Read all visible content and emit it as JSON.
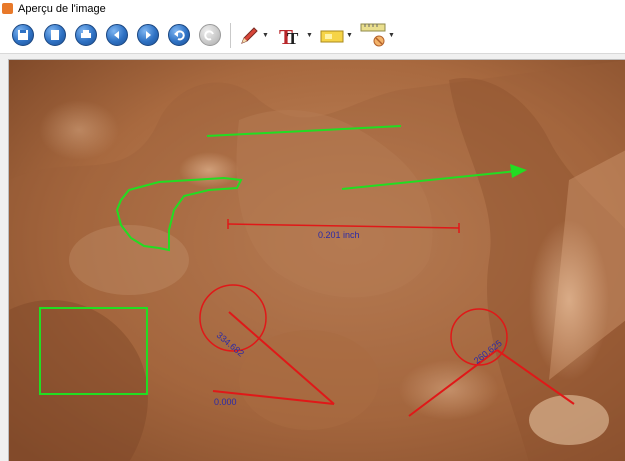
{
  "window": {
    "title": "Aperçu de l'image"
  },
  "toolbar": {
    "buttons": [
      {
        "name": "save-icon",
        "tone": "blue"
      },
      {
        "name": "document-icon",
        "tone": "blue"
      },
      {
        "name": "print-icon",
        "tone": "blue"
      },
      {
        "name": "previous-icon",
        "tone": "blue"
      },
      {
        "name": "next-icon",
        "tone": "blue"
      },
      {
        "name": "undo-icon",
        "tone": "blue"
      },
      {
        "name": "redo-icon",
        "tone": "grey"
      }
    ],
    "tools": [
      {
        "name": "pencil-icon"
      },
      {
        "name": "text-icon",
        "label": "T"
      },
      {
        "name": "color-fill-icon"
      },
      {
        "name": "measure-icon"
      }
    ]
  },
  "annotations": {
    "distance_label": "0.201 inch",
    "angle_left_label": "334.682",
    "angle_right_label": "260.625",
    "zero_label": "0.000"
  },
  "colors": {
    "annotation_green": "#22dd22",
    "annotation_red": "#e01818",
    "label_blue": "#2a2aa8",
    "copper_light": "#c98a5c",
    "copper_dark": "#6e3f22"
  }
}
